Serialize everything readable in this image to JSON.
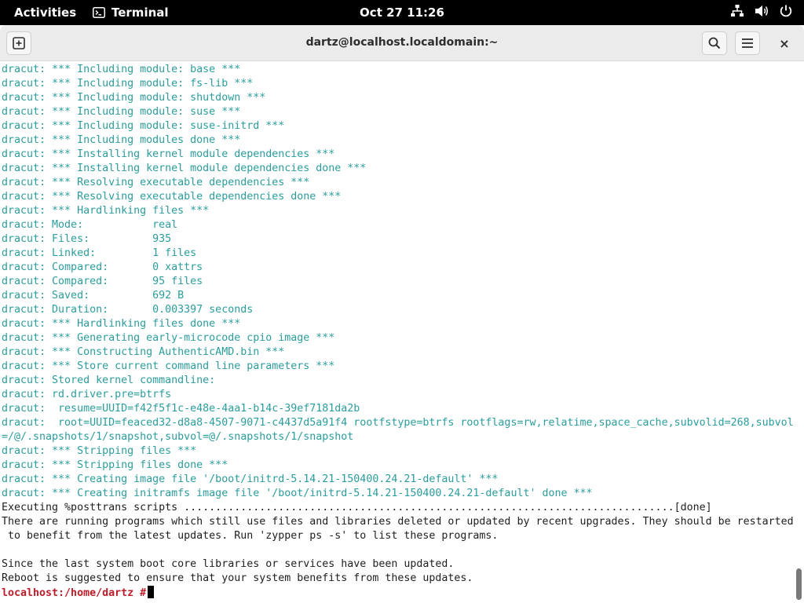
{
  "topbar": {
    "activities": "Activities",
    "app_name": "Terminal",
    "clock": "Oct 27  11:26",
    "icons": [
      "network-icon",
      "volume-icon",
      "power-icon"
    ]
  },
  "window": {
    "title": "dartz@localhost.localdomain:~",
    "new_tab_icon": "new-tab-icon",
    "search_icon": "search-icon",
    "menu_icon": "hamburger-menu-icon",
    "close_label": "×"
  },
  "terminal": {
    "lines": [
      {
        "text": "dracut: *** Including module: base ***",
        "style": "teal"
      },
      {
        "text": "dracut: *** Including module: fs-lib ***",
        "style": "teal"
      },
      {
        "text": "dracut: *** Including module: shutdown ***",
        "style": "teal"
      },
      {
        "text": "dracut: *** Including module: suse ***",
        "style": "teal"
      },
      {
        "text": "dracut: *** Including module: suse-initrd ***",
        "style": "teal"
      },
      {
        "text": "dracut: *** Including modules done ***",
        "style": "teal"
      },
      {
        "text": "dracut: *** Installing kernel module dependencies ***",
        "style": "teal"
      },
      {
        "text": "dracut: *** Installing kernel module dependencies done ***",
        "style": "teal"
      },
      {
        "text": "dracut: *** Resolving executable dependencies ***",
        "style": "teal"
      },
      {
        "text": "dracut: *** Resolving executable dependencies done ***",
        "style": "teal"
      },
      {
        "text": "dracut: *** Hardlinking files ***",
        "style": "teal"
      },
      {
        "text": "dracut: Mode:           real",
        "style": "teal"
      },
      {
        "text": "dracut: Files:          935",
        "style": "teal"
      },
      {
        "text": "dracut: Linked:         1 files",
        "style": "teal"
      },
      {
        "text": "dracut: Compared:       0 xattrs",
        "style": "teal"
      },
      {
        "text": "dracut: Compared:       95 files",
        "style": "teal"
      },
      {
        "text": "dracut: Saved:          692 B",
        "style": "teal"
      },
      {
        "text": "dracut: Duration:       0.003397 seconds",
        "style": "teal"
      },
      {
        "text": "dracut: *** Hardlinking files done ***",
        "style": "teal"
      },
      {
        "text": "dracut: *** Generating early-microcode cpio image ***",
        "style": "teal"
      },
      {
        "text": "dracut: *** Constructing AuthenticAMD.bin ***",
        "style": "teal"
      },
      {
        "text": "dracut: *** Store current command line parameters ***",
        "style": "teal"
      },
      {
        "text": "dracut: Stored kernel commandline:",
        "style": "teal"
      },
      {
        "text": "dracut: rd.driver.pre=btrfs",
        "style": "teal"
      },
      {
        "text": "dracut:  resume=UUID=f42f5f1c-e48e-4aa1-b14c-39ef7181da2b",
        "style": "teal"
      },
      {
        "text": "dracut:  root=UUID=feaced32-d8a8-4507-9071-c4437d5a91f4 rootfstype=btrfs rootflags=rw,relatime,space_cache,subvolid=268,subvol",
        "style": "teal"
      },
      {
        "text": "=/@/.snapshots/1/snapshot,subvol=@/.snapshots/1/snapshot",
        "style": "teal"
      },
      {
        "text": "dracut: *** Stripping files ***",
        "style": "teal"
      },
      {
        "text": "dracut: *** Stripping files done ***",
        "style": "teal"
      },
      {
        "text": "dracut: *** Creating image file '/boot/initrd-5.14.21-150400.24.21-default' ***",
        "style": "teal"
      },
      {
        "text": "dracut: *** Creating initramfs image file '/boot/initrd-5.14.21-150400.24.21-default' done ***",
        "style": "teal"
      },
      {
        "text": "Executing %posttrans scripts ..............................................................................[done]",
        "style": "black"
      },
      {
        "text": "There are running programs which still use files and libraries deleted or updated by recent upgrades. They should be restarted",
        "style": "black"
      },
      {
        "text": " to benefit from the latest updates. Run 'zypper ps -s' to list these programs.",
        "style": "black"
      },
      {
        "text": "",
        "style": "black"
      },
      {
        "text": "Since the last system boot core libraries or services have been updated.",
        "style": "black"
      },
      {
        "text": "Reboot is suggested to ensure that your system benefits from these updates.",
        "style": "black"
      }
    ],
    "prompt": "localhost:/home/dartz #"
  }
}
